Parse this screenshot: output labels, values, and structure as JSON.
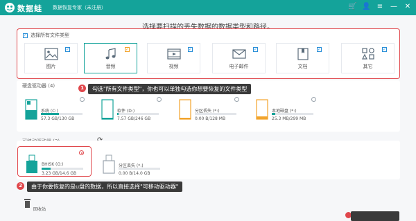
{
  "app": {
    "name": "数据蛙",
    "subtitle": "数据恢复专家（未注册）"
  },
  "page_title": "选择要扫描的丢失数据的数据类型和路径。",
  "file_types": {
    "select_all_label": "选择所有文件类型",
    "items": [
      {
        "label": "图片",
        "icon": "image-icon"
      },
      {
        "label": "音频",
        "icon": "music-icon"
      },
      {
        "label": "视频",
        "icon": "video-icon"
      },
      {
        "label": "电子邮件",
        "icon": "mail-icon"
      },
      {
        "label": "文档",
        "icon": "document-icon"
      },
      {
        "label": "其它",
        "icon": "other-icon"
      }
    ]
  },
  "hard_disks": {
    "label": "硬盘驱动器 (4)",
    "items": [
      {
        "name": "系统 (C:)",
        "size": "57.3 GB/130 GB",
        "used_fraction": 0.44
      },
      {
        "name": "软件 (D:)",
        "size": "7.57 GB/246 GB",
        "used_fraction": 0.03
      },
      {
        "name": "分区丢失 (*:)",
        "size": "0.00 B/128 MB",
        "used_fraction": 0
      },
      {
        "name": "本地磁盘 (*:)",
        "size": "25.3 MB/299 MB",
        "used_fraction": 0.08
      }
    ]
  },
  "removable": {
    "label": "可移动驱动器 (2)",
    "items": [
      {
        "name": "BHISK (G:)",
        "size": "3.23 GB/14.6 GB",
        "used_fraction": 0.22
      },
      {
        "name": "分区丢失 (*:)",
        "size": "0.00 B/14.0 GB",
        "used_fraction": 0
      }
    ]
  },
  "annotations": {
    "one_num": "1",
    "one_text": "勾选\"所有文件类型\"，你也可以单独勾选你想要恢复的文件类型",
    "two_num": "2",
    "two_text": "由于你要恢复的是u盘的数据，所以直接选择\"可移动驱动器\""
  },
  "recycle_bin_label": "回收站",
  "colors": {
    "accent": "#14a39a",
    "highlight": "#e0474c",
    "annotation_bg": "#3a3a3a"
  }
}
